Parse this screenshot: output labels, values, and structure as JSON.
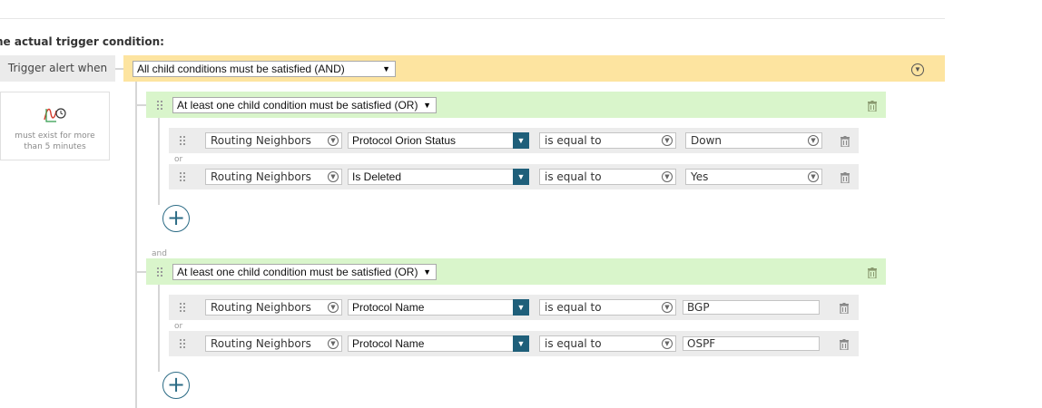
{
  "section_title": "he actual trigger condition:",
  "trigger": {
    "label": "Trigger alert when",
    "condition_select": "All child conditions must be satisfied (AND)",
    "collapse_icon": "chevron-down-circle-icon"
  },
  "time_condition": {
    "icon": "time-condition-icon",
    "text_line1": "must exist for more",
    "text_line2": "than 5 minutes"
  },
  "join_and": "and",
  "groups": [
    {
      "select": "At least one child condition must be satisfied (OR)",
      "rows": [
        {
          "object": "Routing Neighbors",
          "field": "Protocol Orion Status",
          "operator": "is equal to",
          "value": "Down",
          "value_type": "dropdown"
        },
        {
          "object": "Routing Neighbors",
          "field": "Is Deleted",
          "operator": "is equal to",
          "value": "Yes",
          "value_type": "dropdown"
        }
      ],
      "join_label": "or"
    },
    {
      "select": "At least one child condition must be satisfied (OR)",
      "rows": [
        {
          "object": "Routing Neighbors",
          "field": "Protocol Name",
          "operator": "is equal to",
          "value": "BGP",
          "value_type": "text"
        },
        {
          "object": "Routing Neighbors",
          "field": "Protocol Name",
          "operator": "is equal to",
          "value": "OSPF",
          "value_type": "text"
        }
      ],
      "join_label": "or"
    }
  ],
  "add_button_symbol": "+",
  "colors": {
    "and_bar": "#fde4a0",
    "or_bar": "#d9f5cb",
    "field_button": "#1f5f7a",
    "add_button": "#2b6b85"
  }
}
